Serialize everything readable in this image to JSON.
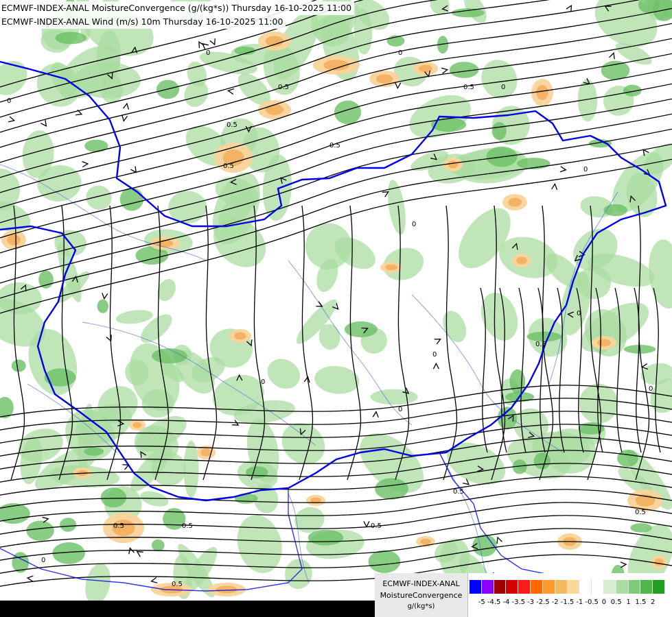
{
  "header": {
    "line1": "ECMWF-INDEX-ANAL MoistureConvergence (g/(kg*s)) Thursday 16-10-2025 11:00",
    "line2": "ECMWF-INDEX-ANAL Wind (m/s) 10m Thursday 16-10-2025 11:00"
  },
  "legend": {
    "product": "ECMWF-INDEX-ANAL",
    "parameter": "MoistureConvergence",
    "unit": "g/(kg*s)",
    "colors": [
      "#0000ff",
      "#8a00ff",
      "#a00000",
      "#d40000",
      "#ff1a1a",
      "#ff6a00",
      "#ff9a2a",
      "#f7b95e",
      "#fbd898",
      "#ffffff",
      "#ffffff",
      "#d7efd0",
      "#a9dca1",
      "#7fca77",
      "#4fb64a",
      "#1f9e1f"
    ],
    "ticks": [
      "-5",
      "-4.5",
      "-4",
      "-3.5",
      "-3",
      "-2.5",
      "-2",
      "-1.5",
      "-1",
      "-0.5",
      "0",
      "0.5",
      "1",
      "1.5",
      "2"
    ]
  },
  "map": {
    "contour_labels": [
      "0",
      "0.5"
    ],
    "colors": {
      "border": "#0000e6",
      "river": "#4a6fdc",
      "streamline": "#000000",
      "convergence_weak": "#d7efd0",
      "convergence_mid": "#a9dca1",
      "convergence_strong": "#6cc166",
      "divergence_weak": "#f9d49a",
      "divergence_mid": "#f3b264"
    }
  }
}
